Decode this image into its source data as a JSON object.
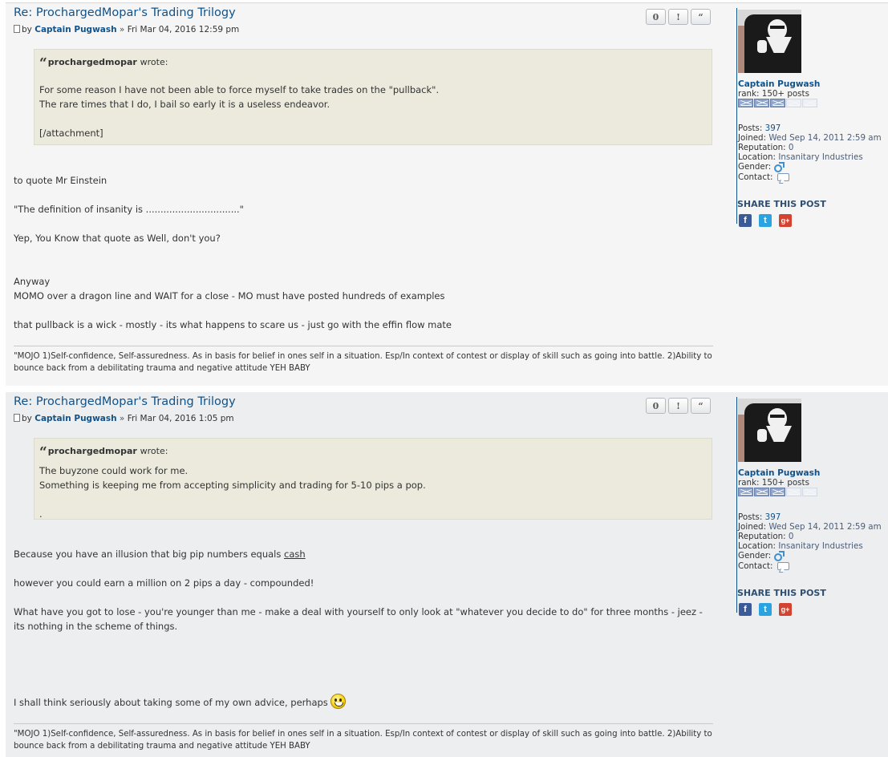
{
  "posts": [
    {
      "title": "Re: ProchargedMopar's Trading Trilogy",
      "by": "by",
      "author": "Captain Pugwash",
      "date": "Fri Mar 04, 2016 12:59 pm",
      "actions": [
        "0",
        "!",
        "“"
      ],
      "quote": {
        "author": "prochargedmopar",
        "wrote": "wrote:",
        "lines": [
          "For some reason I have not been able to force myself to take trades on the \"pullback\".",
          "The rare times that I do, I bail so early it is a useless endeavor.",
          "",
          "[/attachment]"
        ]
      },
      "body": [
        "to quote Mr Einstein",
        "\"The definition of insanity is ................................\"",
        "Yep, You Know that quote as Well, don't you?",
        "Anyway",
        "MOMO over a dragon line and WAIT for a close - MO must have posted hundreds of examples",
        "that pullback is a wick - mostly - its what happens to scare us - just go with the effin flow mate"
      ],
      "signature": "\"MOJO 1)Self-confidence, Self-assuredness. As in basis for belief in ones self in a situation. Esp/In context of contest or display of skill such as going into battle. 2)Ability to bounce back from a debilitating trauma and negative attitude YEH BABY",
      "profile": {
        "name": "Captain Pugwash",
        "rank": "rank: 150+ posts",
        "posts_label": "Posts:",
        "posts": "397",
        "joined_label": "Joined:",
        "joined": "Wed Sep 14, 2011 2:59 am",
        "reputation_label": "Reputation:",
        "reputation": "0",
        "location_label": "Location:",
        "location": "Insanitary Industries",
        "gender_label": "Gender:",
        "contact_label": "Contact:",
        "share_title": "SHARE THIS POST",
        "share_icons": [
          "f",
          "t",
          "g+"
        ]
      }
    },
    {
      "title": "Re: ProchargedMopar's Trading Trilogy",
      "by": "by",
      "author": "Captain Pugwash",
      "date": "Fri Mar 04, 2016 1:05 pm",
      "actions": [
        "0",
        "!",
        "“"
      ],
      "quote": {
        "author": "prochargedmopar",
        "wrote": "wrote:",
        "lines": [
          "The buyzone could work for me.",
          "Something is keeping me from accepting simplicity and trading for 5-10 pips a pop.",
          "",
          "."
        ]
      },
      "body": [
        "Because you have an illusion that big pip numbers equals",
        "cash",
        "however you could earn a million on 2 pips a day - compounded!",
        "What have you got to lose - you're younger than me - make a deal with yourself to only look at \"whatever you decide to do\" for three months - jeez -",
        "its nothing in the scheme of things.",
        "I shall think seriously about taking some of my own advice, perhaps"
      ],
      "signature": "\"MOJO 1)Self-confidence, Self-assuredness. As in basis for belief in ones self in a situation. Esp/In context of contest or display of skill such as going into battle. 2)Ability to bounce back from a debilitating trauma and negative attitude YEH BABY",
      "profile": {
        "name": "Captain Pugwash",
        "rank": "rank: 150+ posts",
        "posts_label": "Posts:",
        "posts": "397",
        "joined_label": "Joined:",
        "joined": "Wed Sep 14, 2011 2:59 am",
        "reputation_label": "Reputation:",
        "reputation": "0",
        "location_label": "Location:",
        "location": "Insanitary Industries",
        "gender_label": "Gender:",
        "contact_label": "Contact:",
        "share_title": "SHARE THIS POST",
        "share_icons": [
          "f",
          "t",
          "g+"
        ]
      }
    }
  ],
  "colors": {
    "link": "#105289",
    "quote_bg": "#ebeadd",
    "post1_bg": "#f5f5f5",
    "post2_bg": "#eceef0"
  }
}
